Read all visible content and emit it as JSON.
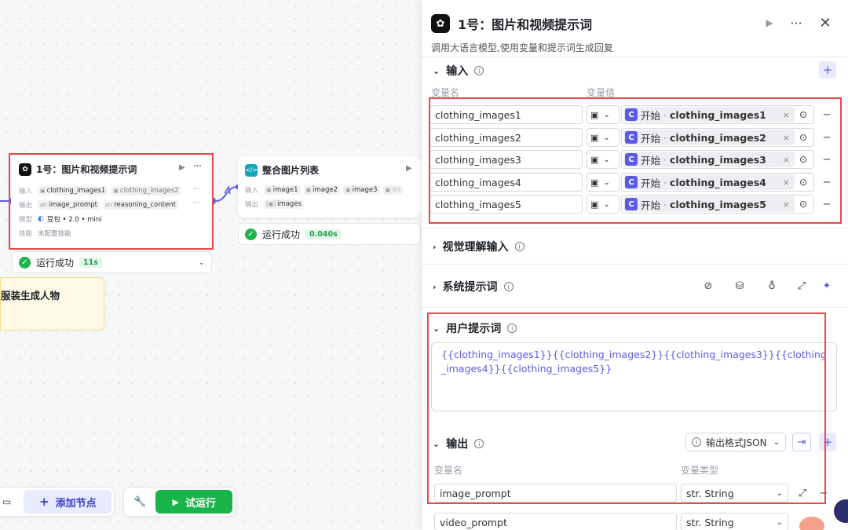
{
  "canvas": {
    "node1": {
      "title": "1号：图片和视频提示词",
      "input_label": "输入",
      "input_chips": [
        "clothing_images1",
        "clothing_images2"
      ],
      "output_label": "输出",
      "output_chips": [
        "image_prompt",
        "reasoning_content"
      ],
      "model_label": "模型",
      "model_value": "豆包 • 2.0 • mini",
      "skill_label": "技能",
      "skill_value": "未配置技能",
      "status_text": "运行成功",
      "status_time": "11s"
    },
    "node2": {
      "title": "整合图片列表",
      "input_label": "输入",
      "input_chips": [
        "image1",
        "image2",
        "image3",
        "im"
      ],
      "output_label": "输出",
      "output_chips": [
        "images"
      ],
      "status_text": "运行成功",
      "status_time": "0.040s"
    },
    "note_text": "服装生成人物",
    "bottom": {
      "add_node": "添加节点",
      "trial_run": "试运行"
    }
  },
  "panel": {
    "title": "1号：图片和视频提示词",
    "description": "调用大语言模型,使用变量和提示词生成回复",
    "input_section": {
      "title": "输入",
      "col_name": "变量名",
      "col_value": "变量值",
      "rows": [
        {
          "name": "clothing_images1",
          "ref_source": "开始",
          "ref_var": "clothing_images1"
        },
        {
          "name": "clothing_images2",
          "ref_source": "开始",
          "ref_var": "clothing_images2"
        },
        {
          "name": "clothing_images3",
          "ref_source": "开始",
          "ref_var": "clothing_images3"
        },
        {
          "name": "clothing_images4",
          "ref_source": "开始",
          "ref_var": "clothing_images4"
        },
        {
          "name": "clothing_images5",
          "ref_source": "开始",
          "ref_var": "clothing_images5"
        }
      ]
    },
    "vision_section": {
      "title": "视觉理解输入"
    },
    "system_prompt_section": {
      "title": "系统提示词"
    },
    "user_prompt_section": {
      "title": "用户提示词",
      "content": "{{clothing_images1}}{{clothing_images2}}{{clothing_images3}}{{clothing_images4}}{{clothing_images5}}"
    },
    "output_section": {
      "title": "输出",
      "format_label": "输出格式JSON",
      "col_name": "变量名",
      "col_type": "变量类型",
      "rows": [
        {
          "name": "image_prompt",
          "type": "str. String"
        },
        {
          "name": "video_prompt",
          "type": "str. String"
        }
      ]
    }
  }
}
